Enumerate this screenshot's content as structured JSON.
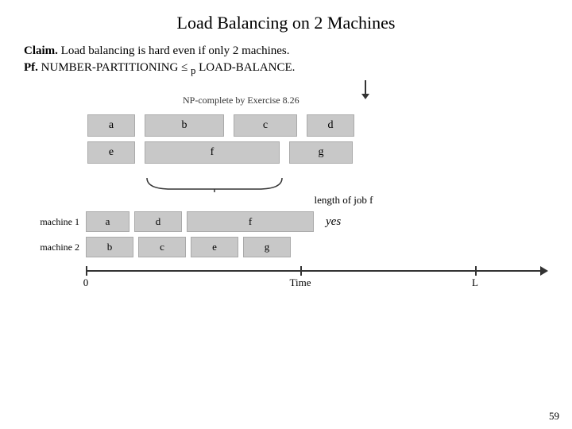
{
  "title": "Load Balancing on 2 Machines",
  "claim": {
    "label": "Claim.",
    "text": "  Load balancing is hard even if only 2 machines."
  },
  "pf": {
    "label": "Pf.",
    "text": "  NUMBER-PARTITIONING ≤",
    "subscript": "p",
    "text2": " LOAD-BALANCE."
  },
  "np_complete": "NP-complete by Exercise 8.26",
  "job_row1": [
    "a",
    "b",
    "c",
    "d"
  ],
  "job_row1_widths": [
    60,
    100,
    80,
    60
  ],
  "job_row2": [
    "e",
    "f",
    "g"
  ],
  "job_row2_widths": [
    60,
    170,
    80
  ],
  "brace_label": "length of job f",
  "machine1": {
    "label": "machine 1",
    "jobs": [
      "a",
      "d",
      "f"
    ],
    "widths": [
      55,
      60,
      160
    ]
  },
  "machine2": {
    "label": "machine 2",
    "jobs": [
      "b",
      "c",
      "e",
      "g"
    ],
    "widths": [
      60,
      60,
      60,
      60
    ]
  },
  "yes_label": "yes",
  "timeline": {
    "start": "0",
    "middle": "Time",
    "end": "L"
  },
  "page_number": "59"
}
